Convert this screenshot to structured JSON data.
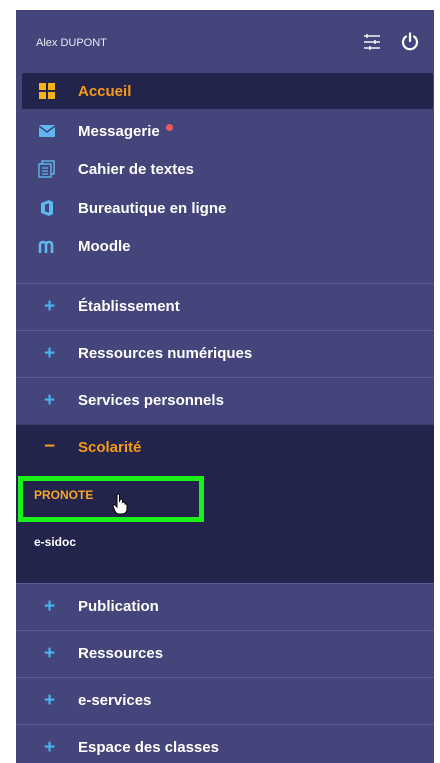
{
  "header": {
    "user_name": "Alex DUPONT",
    "icons": [
      "filter-sliders-icon",
      "power-icon"
    ]
  },
  "nav": {
    "items": [
      {
        "label": "Accueil",
        "icon": "grid-icon",
        "active": true
      },
      {
        "label": "Messagerie",
        "icon": "envelope-icon",
        "has_badge": true
      },
      {
        "label": "Cahier de textes",
        "icon": "notebook-icon"
      },
      {
        "label": "Bureautique en ligne",
        "icon": "office-icon"
      },
      {
        "label": "Moodle",
        "icon": "moodle-icon"
      }
    ]
  },
  "sections": [
    {
      "label": "Établissement",
      "toggle": "+"
    },
    {
      "label": "Ressources numériques",
      "toggle": "+"
    },
    {
      "label": "Services personnels",
      "toggle": "+"
    },
    {
      "label": "Scolarité",
      "toggle": "−",
      "open": true,
      "items": [
        {
          "label": "PRONOTE"
        },
        {
          "label": "e-sidoc"
        }
      ]
    },
    {
      "label": "Publication",
      "toggle": "+"
    },
    {
      "label": "Ressources",
      "toggle": "+"
    },
    {
      "label": "e-services",
      "toggle": "+"
    },
    {
      "label": "Espace des classes",
      "toggle": "+"
    }
  ],
  "colors": {
    "panel_bg": "#44457a",
    "active_bg": "#23244b",
    "accent_orange": "#f59a18",
    "plus_blue": "#42b6f0",
    "highlight_green": "#1af21a",
    "badge_red": "#ef5a5a"
  }
}
